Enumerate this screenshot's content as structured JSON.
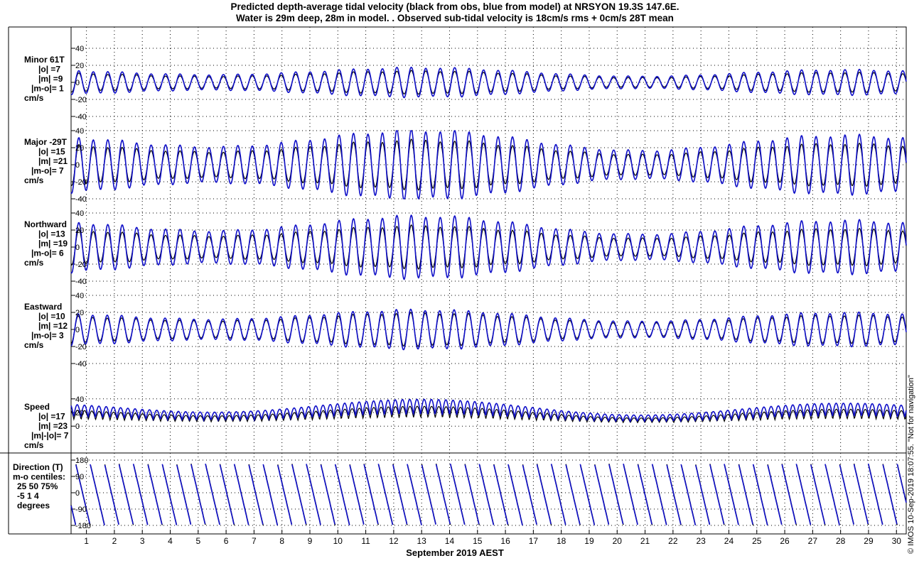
{
  "title_line1": "Predicted depth-average tidal velocity (black from obs, blue from model) at NRSYON 19.3S 147.6E.",
  "title_line2": "Water is 29m deep, 28m in model. . Observed sub-tidal velocity is 18cm/s rms + 0cm/s 28T mean",
  "xlabel": "September 2019 AEST",
  "watermark": "© IMOS 10-Sep-2019 18:07:55. \"Not for navigation\"",
  "colors": {
    "obs": "#000000",
    "model": "#1010c8"
  },
  "chart_data": {
    "type": "line",
    "x_range": [
      0.45,
      30.35
    ],
    "x_ticks": [
      "1",
      "2",
      "3",
      "4",
      "5",
      "6",
      "7",
      "8",
      "9",
      "10",
      "11",
      "12",
      "13",
      "14",
      "15",
      "16",
      "17",
      "18",
      "19",
      "20",
      "21",
      "22",
      "23",
      "24",
      "25",
      "26",
      "27",
      "28",
      "29",
      "30"
    ],
    "panels": [
      {
        "id": "minor",
        "labels": [
          "Minor 61T",
          "|o| =7",
          "|m| =9",
          "|m-o|= 1",
          "cm/s"
        ],
        "ylim": [
          -40,
          40
        ],
        "yticks": [
          "-40",
          "-20",
          "0",
          "20",
          "40"
        ],
        "kind": "vel",
        "obs_amp": 7,
        "model_amp": 9,
        "series": [
          {
            "name": "obs"
          },
          {
            "name": "model"
          }
        ]
      },
      {
        "id": "major",
        "labels": [
          "Major -29T",
          "|o| =15",
          "|m| =21",
          "|m-o|= 7",
          "cm/s"
        ],
        "ylim": [
          -40,
          40
        ],
        "yticks": [
          "-40",
          "-20",
          "0",
          "20",
          "40"
        ],
        "kind": "vel",
        "obs_amp": 15,
        "model_amp": 21,
        "series": [
          {
            "name": "obs"
          },
          {
            "name": "model"
          }
        ]
      },
      {
        "id": "north",
        "labels": [
          "Northward",
          "|o| =13",
          "|m| =19",
          "|m-o|= 6",
          "cm/s"
        ],
        "ylim": [
          -40,
          40
        ],
        "yticks": [
          "-40",
          "-20",
          "0",
          "20",
          "40"
        ],
        "kind": "vel",
        "obs_amp": 13,
        "model_amp": 19,
        "series": [
          {
            "name": "obs"
          },
          {
            "name": "model"
          }
        ]
      },
      {
        "id": "east",
        "labels": [
          "Eastward",
          "|o| =10",
          "|m| =12",
          "|m-o|= 3",
          "cm/s"
        ],
        "ylim": [
          -40,
          40
        ],
        "yticks": [
          "-40",
          "-20",
          "0",
          "20",
          "40"
        ],
        "kind": "vel",
        "obs_amp": 10,
        "model_amp": 12,
        "series": [
          {
            "name": "obs"
          },
          {
            "name": "model"
          }
        ]
      },
      {
        "id": "speed",
        "labels": [
          "Speed",
          "|o| =17",
          "|m| =23",
          "|m|-|o|= 7",
          "cm/s"
        ],
        "ylim": [
          -5,
          45
        ],
        "yticks": [
          "0",
          "20",
          "40"
        ],
        "kind": "speed",
        "obs_amp": 17,
        "model_amp": 23,
        "series": [
          {
            "name": "obs"
          },
          {
            "name": "model"
          }
        ]
      },
      {
        "id": "dir",
        "labels": [
          "Direction (T)",
          "m-o centiles:",
          "25  50  75%",
          "-5   1   4",
          "degrees"
        ],
        "ylim": [
          -180,
          180
        ],
        "yticks": [
          "-180",
          "-90",
          "0",
          "90",
          "180"
        ],
        "kind": "dir",
        "series": [
          {
            "name": "obs"
          },
          {
            "name": "model"
          }
        ]
      }
    ]
  }
}
